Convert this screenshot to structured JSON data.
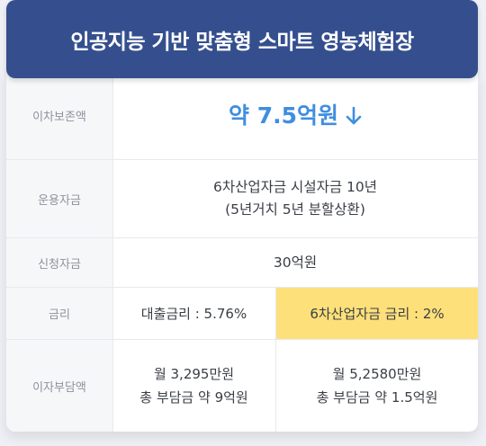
{
  "title": "인공지능 기반 맞춤형 스마트 영농체험장",
  "rows": [
    {
      "label": "이차보존액",
      "value": "약 7.5억원"
    },
    {
      "label": "운용자금",
      "line1": "6차산업자금 시설자금 10년",
      "line2": "(5년거치 5년 분할상환)"
    },
    {
      "label": "신청자금",
      "value": "30억원"
    },
    {
      "label": "금리",
      "left": "대출금리 : 5.76%",
      "right": "6차산업자금 금리 : 2%"
    },
    {
      "label": "이자부담액",
      "left1": "월 3,295만원",
      "left2": "총 부담금 약 9억원",
      "right1": "월 5,2580만원",
      "right2": "총 부담금 약 1.5억원"
    }
  ],
  "colors": {
    "header": "#354f8e",
    "accent": "#3f8ee0",
    "highlight": "#fde07a"
  },
  "icons": {
    "down_arrow": "arrow-down-icon"
  }
}
